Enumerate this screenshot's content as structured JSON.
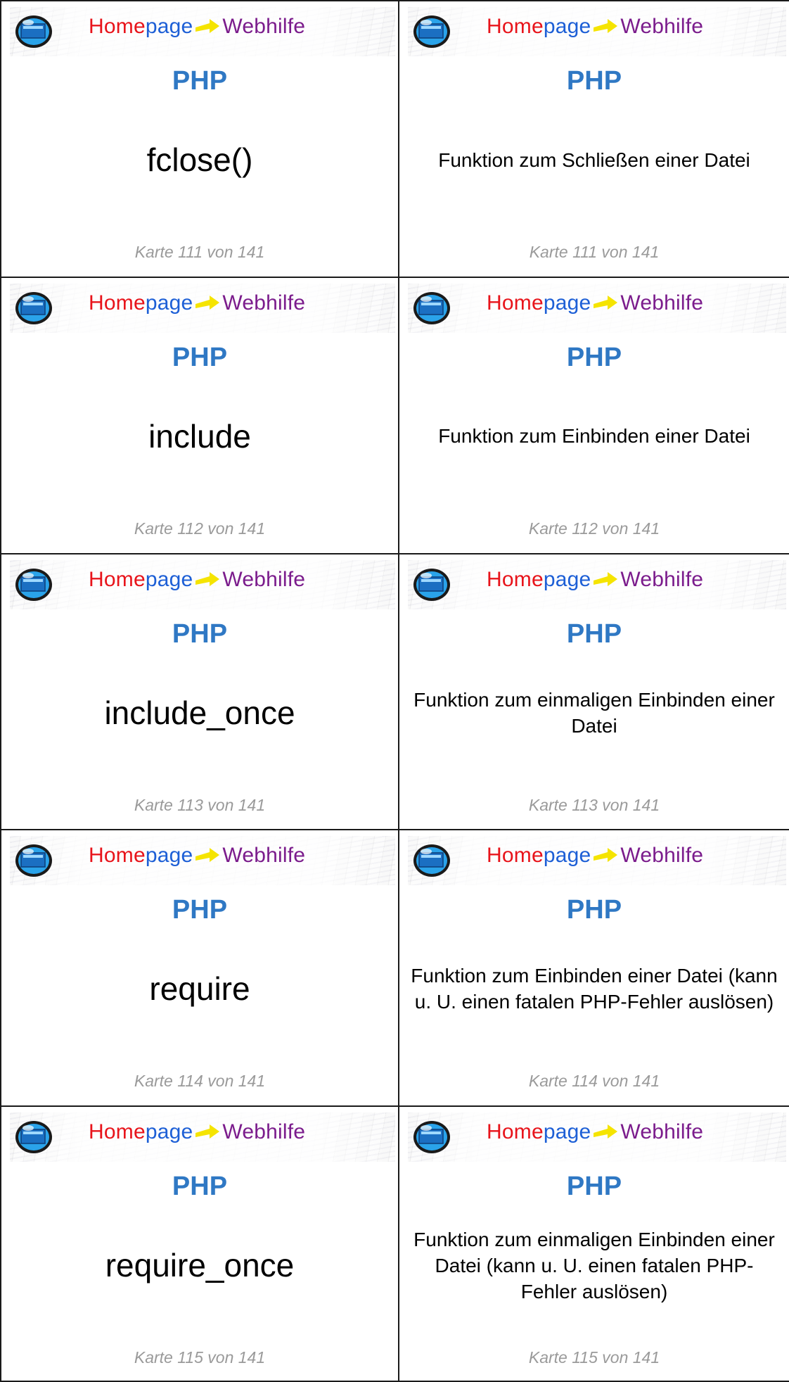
{
  "banner": {
    "home": "Home",
    "page": "page",
    "web": "Webhilfe",
    "icon": "monitor-globe-icon",
    "colors": {
      "home": "#e8141b",
      "page": "#1d5fd6",
      "web": "#7b1c8c",
      "arrow": "#f5e400"
    }
  },
  "subject_color": "#2f78c4",
  "cards": [
    {
      "subject": "PHP",
      "term": "fclose()",
      "definition": "Funktion zum Schließen einer Datei",
      "footer": "Karte 111 von 141"
    },
    {
      "subject": "PHP",
      "term": "include",
      "definition": "Funktion zum Einbinden einer Datei",
      "footer": "Karte 112 von 141"
    },
    {
      "subject": "PHP",
      "term": "include_once",
      "definition": "Funktion zum einmaligen Einbinden einer Datei",
      "footer": "Karte 113 von 141"
    },
    {
      "subject": "PHP",
      "term": "require",
      "definition": "Funktion zum Einbinden einer Datei (kann u. U. einen fatalen PHP-Fehler auslösen)",
      "footer": "Karte 114 von 141"
    },
    {
      "subject": "PHP",
      "term": "require_once",
      "definition": "Funktion zum einmaligen Einbinden einer Datei (kann u. U. einen fatalen PHP-Fehler auslösen)",
      "footer": "Karte 115 von 141"
    }
  ]
}
